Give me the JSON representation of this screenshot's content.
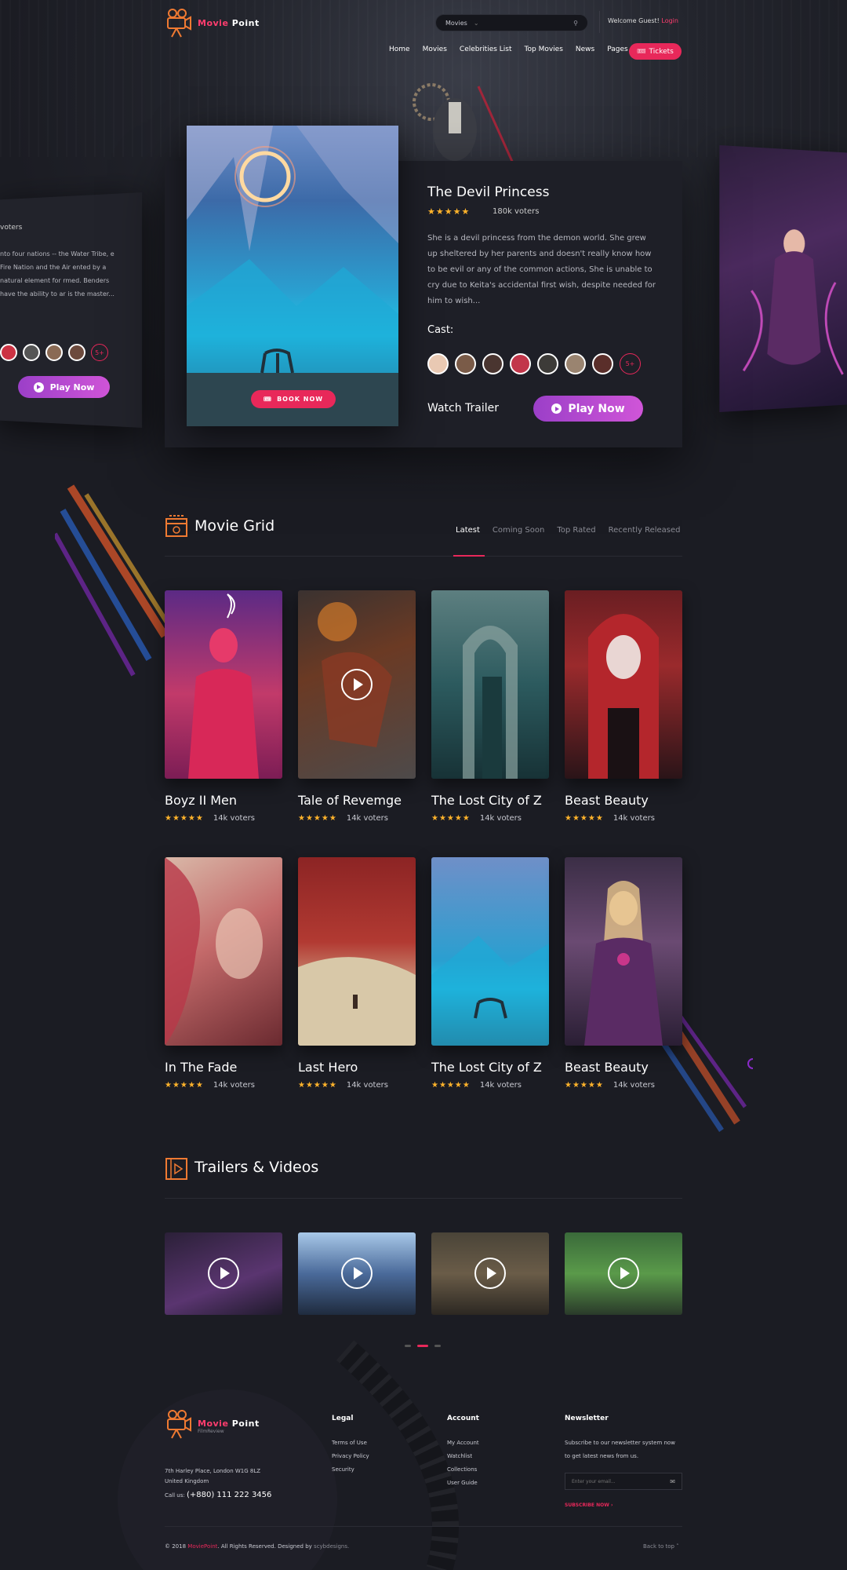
{
  "header": {
    "logo_main": "Movie",
    "logo_sub": "Point",
    "search_value": "Movies",
    "welcome": "Welcome Guest!",
    "login": "Login",
    "nav": [
      "Home",
      "Movies",
      "Celebrities List",
      "Top Movies",
      "News",
      "Pages"
    ],
    "tickets": "Tickets"
  },
  "side_left": {
    "voters": "voters",
    "text": "nto four nations -- the Water Tribe, e Fire Nation and the Air ented by a natural element for rmed. Benders have the ability to ar is the master...",
    "plus": "5+",
    "play": "Play Now"
  },
  "featured": {
    "title": "The Devil Princess",
    "voters": "180k voters",
    "rating": 5,
    "description": "She is a devil princess from the demon world. She grew up sheltered by her parents and doesn't really know how to be evil or any of the common actions,  She is unable to cry due to Keita's accidental first wish, despite needed for him to wish...",
    "cast_label": "Cast:",
    "cast_plus": "5+",
    "watch_trailer": "Watch Trailer",
    "play": "Play Now",
    "book_now": "BOOK NOW"
  },
  "movie_grid": {
    "title": "Movie Grid",
    "tabs": [
      "Latest",
      "Coming Soon",
      "Top Rated",
      "Recently Released"
    ],
    "active_tab": "Latest",
    "movies": [
      {
        "title": "Boyz II Men",
        "voters": "14k voters",
        "rating": 5
      },
      {
        "title": "Tale of Revemge",
        "voters": "14k voters",
        "rating": 5
      },
      {
        "title": "The Lost City of Z",
        "voters": "14k voters",
        "rating": 5
      },
      {
        "title": "Beast Beauty",
        "voters": "14k voters",
        "rating": 5
      },
      {
        "title": "In The Fade",
        "voters": "14k voters",
        "rating": 5
      },
      {
        "title": "Last Hero",
        "voters": "14k voters",
        "rating": 5
      },
      {
        "title": "The Lost City of Z",
        "voters": "14k voters",
        "rating": 5
      },
      {
        "title": "Beast Beauty",
        "voters": "14k voters",
        "rating": 5
      }
    ]
  },
  "trailers": {
    "title": "Trailers & Videos"
  },
  "footer": {
    "logo_main": "Movie",
    "logo_sub": "Point",
    "logo_tag": "FilmReview",
    "address1": "7th Harley Place, London W1G 8LZ",
    "address2": "United Kingdom",
    "call_label": "Call us:",
    "phone": "(+880) 111 222 3456",
    "legal_title": "Legal",
    "legal": [
      "Terms of Use",
      "Privacy Policy",
      "Security"
    ],
    "account_title": "Account",
    "account": [
      "My Account",
      "Watchlist",
      "Collections",
      "User Guide"
    ],
    "newsletter_title": "Newsletter",
    "newsletter_text1": "Subscribe to our newsletter system now",
    "newsletter_text2": "to get latest news from us.",
    "email_placeholder": "Enter your email...",
    "subscribe": "SUBSCRIBE NOW",
    "copyright_a": "© 2018",
    "copyright_brand": "MoviePoint",
    "copyright_b": ". All Rights Reserved. Designed by",
    "copyright_designer": "scybdesigns.",
    "back_to_top": "Back to top"
  },
  "colors": {
    "accent": "#e8285a",
    "purple": "#b44fd0",
    "star": "#ffb32b",
    "bg": "#1b1c23"
  }
}
